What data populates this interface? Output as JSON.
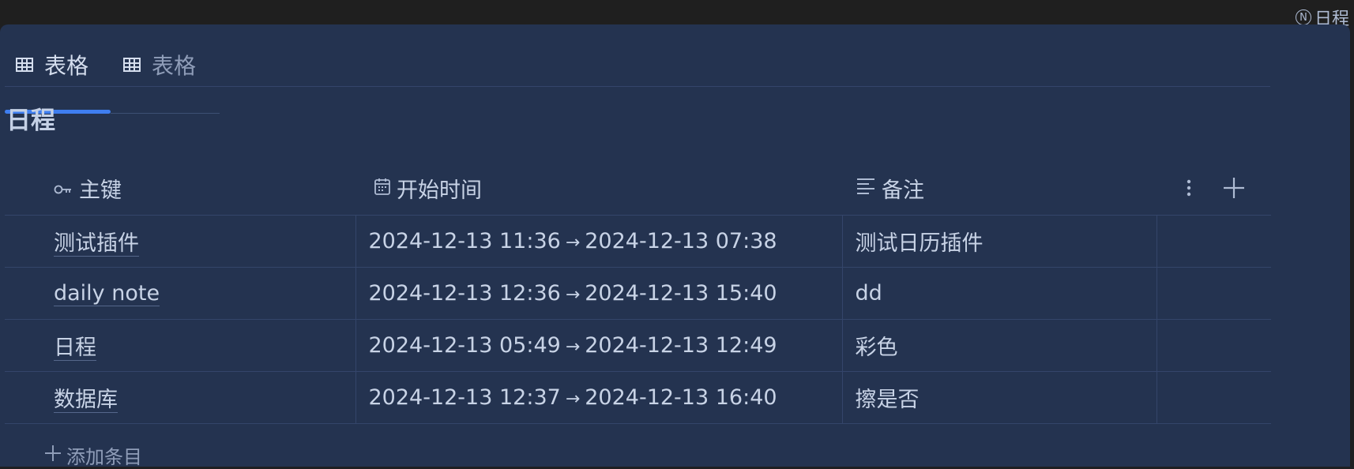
{
  "doc_ref": {
    "icon": "notion-n-icon",
    "label": "日程"
  },
  "tabs": [
    {
      "icon": "table-grid-icon",
      "label": "表格",
      "active": true
    },
    {
      "icon": "table-grid-icon",
      "label": "表格",
      "active": false
    }
  ],
  "database": {
    "title": "日程"
  },
  "columns": [
    {
      "icon": "key-icon",
      "label": "主键"
    },
    {
      "icon": "calendar-icon",
      "label": "开始时间"
    },
    {
      "icon": "text-lines-icon",
      "label": "备注"
    }
  ],
  "column_actions": {
    "more_icon": "more-vertical-icon",
    "add_icon": "plus-icon"
  },
  "rows": [
    {
      "key": "测试插件",
      "start": "2024-12-13 11:36",
      "arrow": "→",
      "end": "2024-12-13 07:38",
      "note": "测试日历插件"
    },
    {
      "key": "daily note",
      "start": "2024-12-13 12:36",
      "arrow": "→",
      "end": "2024-12-13 15:40",
      "note": "dd"
    },
    {
      "key": "日程",
      "start": "2024-12-13 05:49",
      "arrow": "→",
      "end": "2024-12-13 12:49",
      "note": "彩色"
    },
    {
      "key": "数据库",
      "start": "2024-12-13 12:37",
      "arrow": "→",
      "end": "2024-12-13 16:40",
      "note": "擦是否"
    }
  ],
  "add_row": {
    "icon": "plus-icon",
    "label": "添加条目"
  },
  "colors": {
    "background": "#243350",
    "accent": "#3f7ef0",
    "text": "#c8d3e6",
    "muted": "#8f9db8"
  }
}
